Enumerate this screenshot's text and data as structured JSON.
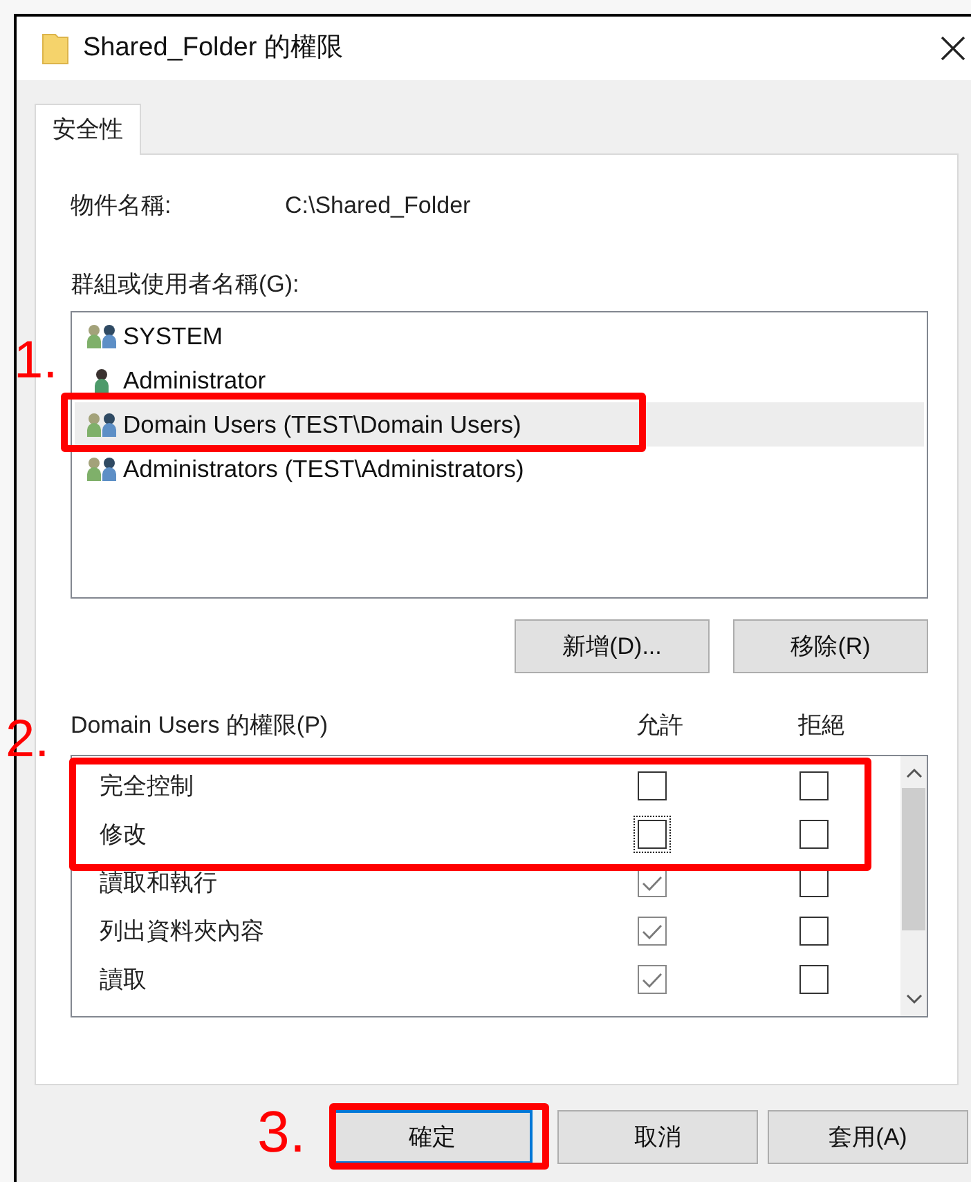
{
  "window": {
    "title": "Shared_Folder 的權限"
  },
  "tabs": [
    {
      "label": "安全性",
      "selected": true
    }
  ],
  "object_name": {
    "label": "物件名稱:",
    "value": "C:\\Shared_Folder"
  },
  "groups": {
    "label": "群組或使用者名稱(G):",
    "items": [
      {
        "name": "SYSTEM",
        "kind": "group",
        "selected": false
      },
      {
        "name": "Administrator",
        "kind": "user",
        "selected": false
      },
      {
        "name": "Domain Users (TEST\\Domain Users)",
        "kind": "group",
        "selected": true
      },
      {
        "name": "Administrators (TEST\\Administrators)",
        "kind": "group",
        "selected": false
      }
    ],
    "buttons": [
      "新增(D)...",
      "移除(R)"
    ]
  },
  "permissions": {
    "label": "Domain Users 的權限(P)",
    "allow_header": "允許",
    "deny_header": "拒絕",
    "rows": [
      {
        "label": "完全控制",
        "allow": {
          "checked": false,
          "disabled": false,
          "focused": false
        },
        "deny": {
          "checked": false,
          "disabled": false
        }
      },
      {
        "label": "修改",
        "allow": {
          "checked": false,
          "disabled": false,
          "focused": true
        },
        "deny": {
          "checked": false,
          "disabled": false
        }
      },
      {
        "label": "讀取和執行",
        "allow": {
          "checked": true,
          "disabled": true,
          "focused": false
        },
        "deny": {
          "checked": false,
          "disabled": false
        }
      },
      {
        "label": "列出資料夾內容",
        "allow": {
          "checked": true,
          "disabled": true,
          "focused": false
        },
        "deny": {
          "checked": false,
          "disabled": false
        }
      },
      {
        "label": "讀取",
        "allow": {
          "checked": true,
          "disabled": true,
          "focused": false
        },
        "deny": {
          "checked": false,
          "disabled": false
        }
      }
    ]
  },
  "buttons": [
    {
      "label": "確定",
      "default": true
    },
    {
      "label": "取消",
      "default": false
    },
    {
      "label": "套用(A)",
      "default": false
    }
  ],
  "annotations": [
    {
      "number": "1."
    },
    {
      "number": "2."
    },
    {
      "number": "3."
    }
  ]
}
